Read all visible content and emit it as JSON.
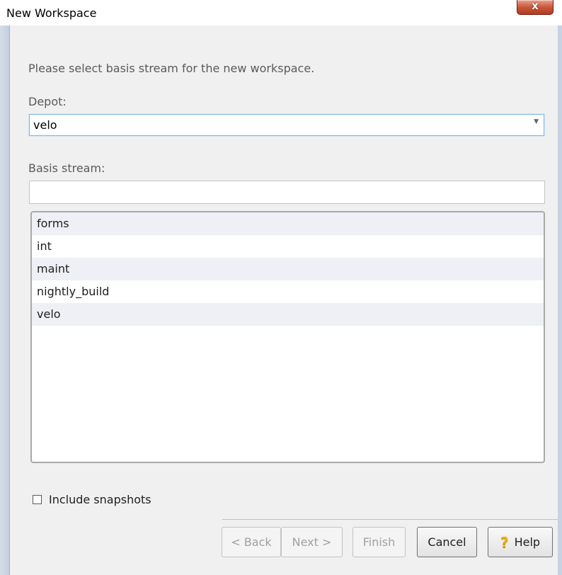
{
  "window": {
    "title": "New Workspace",
    "close_glyph": "x"
  },
  "instruction": "Please select basis stream for the new workspace.",
  "depot": {
    "label": "Depot:",
    "value": "velo"
  },
  "basis_stream": {
    "label": "Basis stream:",
    "filter_value": "",
    "items": [
      "forms",
      "int",
      "maint",
      "nightly_build",
      "velo"
    ]
  },
  "include_snapshots": {
    "label": "Include snapshots",
    "checked": false
  },
  "buttons": {
    "back": "< Back",
    "next": "Next >",
    "finish": "Finish",
    "cancel": "Cancel",
    "help": "Help"
  },
  "icons": {
    "help": "question-mark-icon",
    "dropdown": "chevron-down-icon"
  },
  "colors": {
    "accent_focus": "#7eb4ea",
    "close_button": "#c9573c",
    "help_icon": "#f0b010"
  }
}
